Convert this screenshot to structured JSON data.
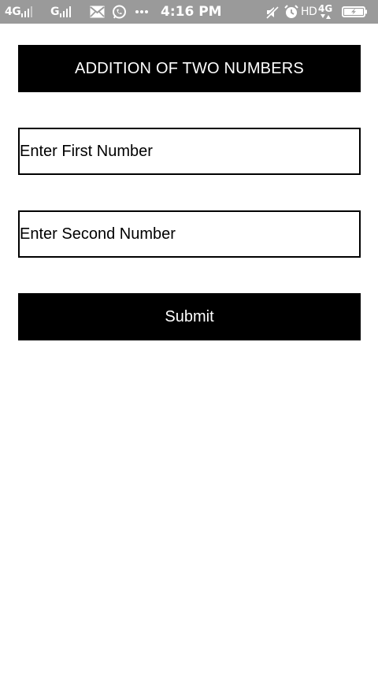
{
  "status_bar": {
    "sim1_network": "4G",
    "sim2_network": "G",
    "time": "4:16 PM",
    "hd": "HD",
    "data_network": "4G",
    "icons": [
      "mail-icon",
      "whatsapp-icon",
      "more-dots-icon",
      "muted-icon",
      "alarm-icon",
      "data-arrows-icon",
      "battery-charging-icon"
    ],
    "background_color": "#9a9a9a"
  },
  "app": {
    "title": "ADDITION OF TWO NUMBERS",
    "first_input": {
      "placeholder": "Enter First Number",
      "value": ""
    },
    "second_input": {
      "placeholder": "Enter Second Number",
      "value": ""
    },
    "submit_label": "Submit",
    "accent_color": "#000000"
  }
}
